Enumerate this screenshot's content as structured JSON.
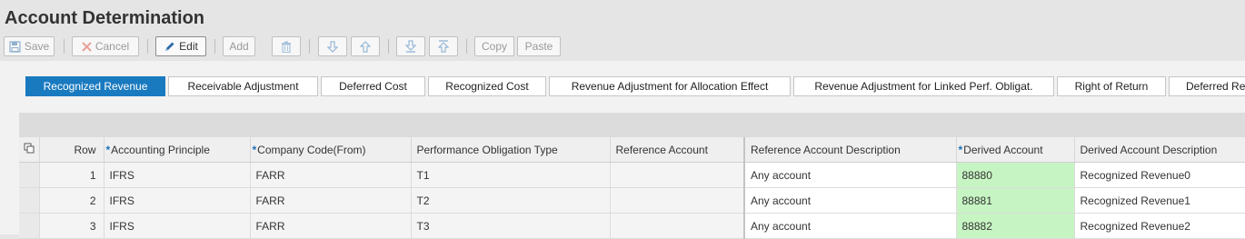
{
  "app": {
    "title": "Account Determination"
  },
  "toolbar": {
    "save": "Save",
    "cancel": "Cancel",
    "edit": "Edit",
    "add": "Add",
    "copy": "Copy",
    "paste": "Paste",
    "icons": {
      "save": "floppy-disk-icon",
      "cancel": "x-icon",
      "edit": "pencil-icon",
      "delete": "trash-icon",
      "move_down": "arrow-down-icon",
      "move_up": "arrow-up-icon",
      "move_bottom": "arrow-to-bottom-icon",
      "move_top": "arrow-to-top-icon"
    }
  },
  "tabs": [
    {
      "label": "Recognized Revenue",
      "selected": true
    },
    {
      "label": "Receivable Adjustment"
    },
    {
      "label": "Deferred Cost"
    },
    {
      "label": "Recognized Cost"
    },
    {
      "label": "Revenue Adjustment for Allocation Effect"
    },
    {
      "label": "Revenue Adjustment for Linked Perf. Obligat."
    },
    {
      "label": "Right of Return"
    },
    {
      "label": "Deferred Re"
    }
  ],
  "table": {
    "select_all_icon": "select-all-icon",
    "columns": [
      {
        "label": "Row"
      },
      {
        "label": "Accounting Principle",
        "required": true,
        "marker": "*"
      },
      {
        "label": "Company Code(From)",
        "required": true,
        "marker": "*"
      },
      {
        "label": "Performance Obligation Type"
      },
      {
        "label": "Reference Account"
      },
      {
        "label": "Reference Account Description"
      },
      {
        "label": "Derived Account",
        "required": true,
        "marker": "*"
      },
      {
        "label": "Derived Account Description"
      }
    ],
    "rows": [
      {
        "row": "1",
        "principle": "IFRS",
        "company": "FARR",
        "pob_type": "T1",
        "ref_account": "",
        "ref_desc": "Any account",
        "derived": "88880",
        "derived_desc": "Recognized Revenue0"
      },
      {
        "row": "2",
        "principle": "IFRS",
        "company": "FARR",
        "pob_type": "T2",
        "ref_account": "",
        "ref_desc": "Any account",
        "derived": "88881",
        "derived_desc": "Recognized Revenue1"
      },
      {
        "row": "3",
        "principle": "IFRS",
        "company": "FARR",
        "pob_type": "T3",
        "ref_account": "",
        "ref_desc": "Any account",
        "derived": "88882",
        "derived_desc": "Recognized Revenue2"
      }
    ]
  },
  "colors": {
    "selected_tab": "#1a7ac0",
    "derived_cell": "#c6f4c2",
    "required_marker": "#1a6fb5"
  }
}
